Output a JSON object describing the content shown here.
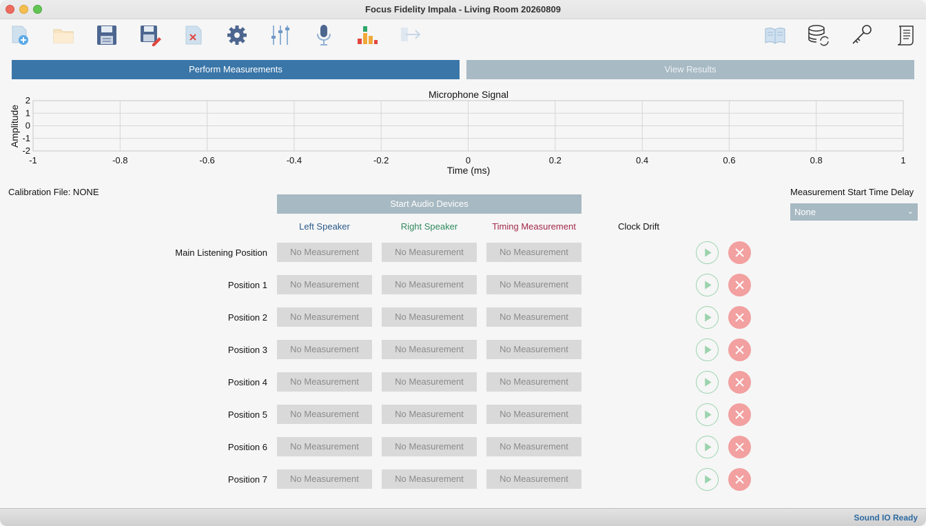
{
  "window": {
    "title": "Focus Fidelity Impala - Living Room 20260809"
  },
  "toolbar": {
    "icons": [
      "new-document-icon",
      "open-folder-icon",
      "save-icon",
      "save-as-icon",
      "close-document-icon",
      "settings-gear-icon",
      "mixer-sliders-icon",
      "microphone-icon",
      "level-meter-icon",
      "export-arrow-icon",
      "manual-book-icon",
      "database-sync-icon",
      "license-key-icon",
      "script-scroll-icon"
    ]
  },
  "tabs": {
    "perform": "Perform Measurements",
    "results": "View Results"
  },
  "chart_data": {
    "type": "line",
    "title": "Microphone Signal",
    "xlabel": "Time (ms)",
    "ylabel": "Amplitude",
    "xlim": [
      -1,
      1
    ],
    "ylim": [
      -2,
      2
    ],
    "x_ticks": [
      "-1",
      "-0.8",
      "-0.6",
      "-0.4",
      "-0.2",
      "0",
      "0.2",
      "0.4",
      "0.6",
      "0.8",
      "1"
    ],
    "y_ticks": [
      "2",
      "1",
      "0",
      "-1",
      "-2"
    ],
    "grid": true,
    "series": []
  },
  "calibration": {
    "label": "Calibration File: NONE"
  },
  "start_time_delay": {
    "label": "Measurement Start Time Delay",
    "value": "None"
  },
  "start_audio": {
    "label": "Start Audio Devices"
  },
  "columns": {
    "left": "Left Speaker",
    "right": "Right Speaker",
    "timing": "Timing Measurement",
    "drift": "Clock Drift"
  },
  "colors": {
    "left": "#2a5a8a",
    "right": "#2f8a5f",
    "timing": "#a22a4a",
    "accent": "#3a76a8"
  },
  "positions": [
    {
      "label": "Main Listening Position",
      "left": "No Measurement",
      "right": "No Measurement",
      "timing": "No Measurement"
    },
    {
      "label": "Position 1",
      "left": "No Measurement",
      "right": "No Measurement",
      "timing": "No Measurement"
    },
    {
      "label": "Position 2",
      "left": "No Measurement",
      "right": "No Measurement",
      "timing": "No Measurement"
    },
    {
      "label": "Position 3",
      "left": "No Measurement",
      "right": "No Measurement",
      "timing": "No Measurement"
    },
    {
      "label": "Position 4",
      "left": "No Measurement",
      "right": "No Measurement",
      "timing": "No Measurement"
    },
    {
      "label": "Position 5",
      "left": "No Measurement",
      "right": "No Measurement",
      "timing": "No Measurement"
    },
    {
      "label": "Position 6",
      "left": "No Measurement",
      "right": "No Measurement",
      "timing": "No Measurement"
    },
    {
      "label": "Position 7",
      "left": "No Measurement",
      "right": "No Measurement",
      "timing": "No Measurement"
    }
  ],
  "status": {
    "text": "Sound IO Ready"
  }
}
